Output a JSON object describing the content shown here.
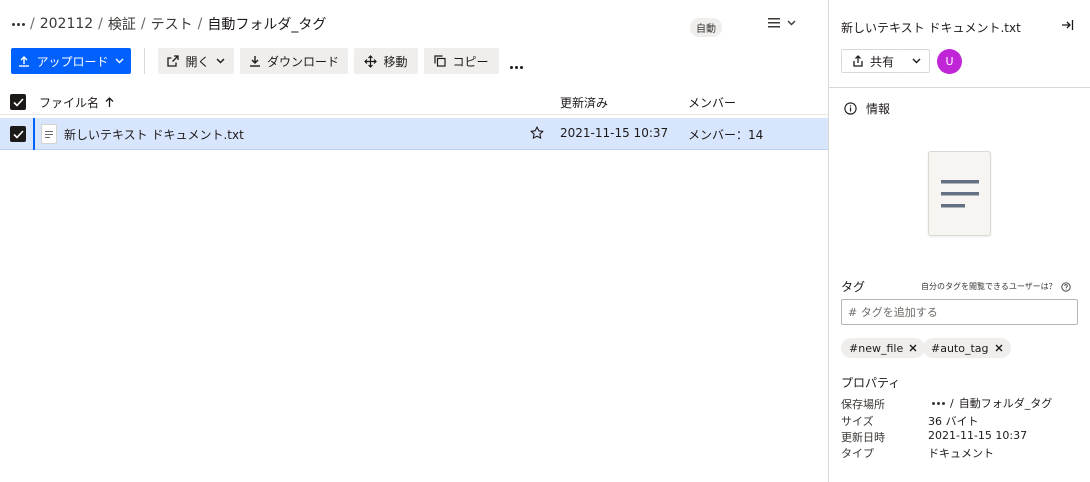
{
  "breadcrumb": {
    "items": [
      "202112",
      "検証",
      "テスト"
    ],
    "current": "自動フォルダ_タグ",
    "separator": "/"
  },
  "header": {
    "badge": "自動"
  },
  "toolbar": {
    "upload_label": "アップロード",
    "open_label": "開く",
    "download_label": "ダウンロード",
    "move_label": "移動",
    "copy_label": "コピー"
  },
  "table": {
    "columns": {
      "name": "ファイル名",
      "modified": "更新済み",
      "members": "メンバー"
    },
    "rows": [
      {
        "name": "新しいテキスト ドキュメント.txt",
        "modified": "2021-11-15 10:37",
        "members": "メンバー：14",
        "selected": true
      }
    ]
  },
  "panel": {
    "title": "新しいテキスト ドキュメント.txt",
    "share_label": "共有",
    "avatar_initial": "U",
    "info_label": "情報",
    "tags": {
      "heading": "タグ",
      "help_text": "自分のタグを閲覧できるユーザーは？",
      "input_placeholder": "# タグを追加する",
      "chips": [
        "#new_file",
        "#auto_tag"
      ]
    },
    "properties": {
      "heading": "プロパティ",
      "location_label": "保存場所",
      "location_sep": "/",
      "location_value": "自動フォルダ_タグ",
      "size_label": "サイズ",
      "size_value": "36 バイト",
      "modified_label": "更新日時",
      "modified_value": "2021-11-15 10:37",
      "type_label": "タイプ",
      "type_value": "ドキュメント"
    }
  },
  "colors": {
    "accent": "#0061fe",
    "selected_row": "#d8e6fd",
    "avatar": "#c025d8"
  }
}
